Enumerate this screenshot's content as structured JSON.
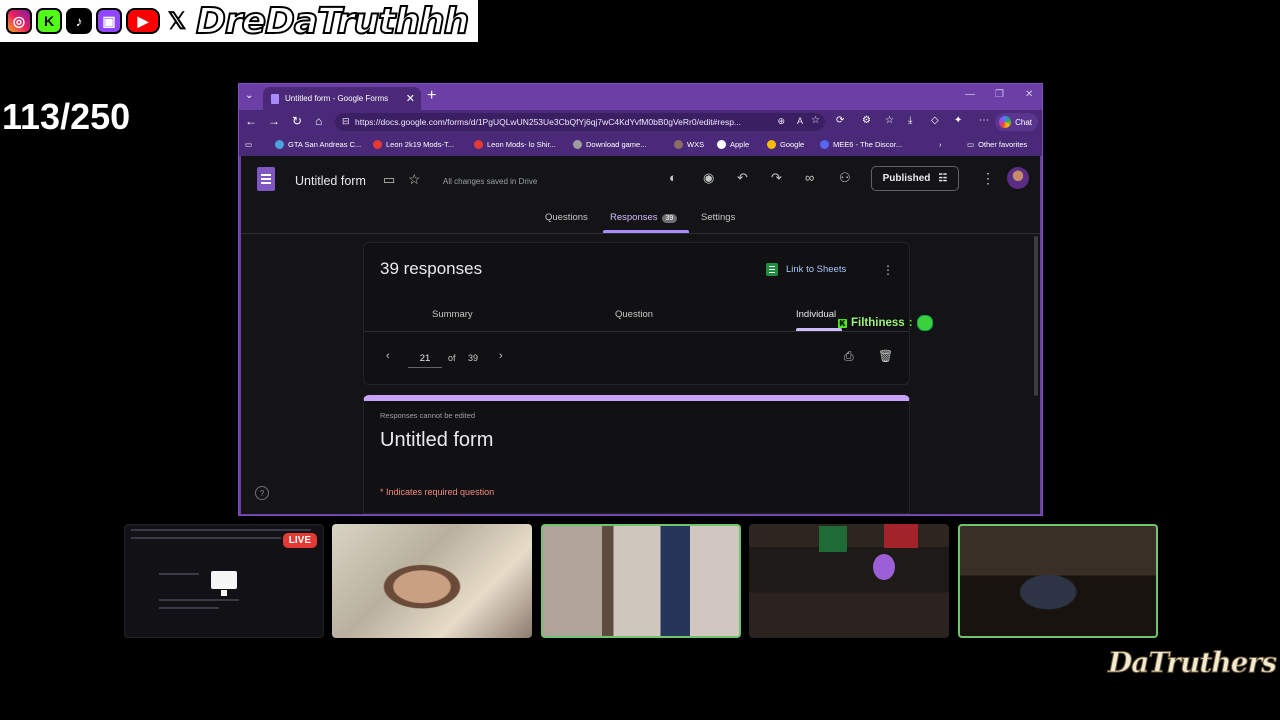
{
  "overlay": {
    "social_name": "DreDaTruthhh",
    "counter": "113/250",
    "chat": {
      "name": "Filthiness",
      "sep": " :"
    },
    "live_badge": "LIVE",
    "brand_logo": "DaTruthers"
  },
  "browser": {
    "tab_title": "Untitled form - Google Forms",
    "url": "https://docs.google.com/forms/d/1PgUQLwUN253Ue3CbQfYj6qj7wC4KdYvfM0bB0gVeRr0/edit#resp...",
    "chat_label": "Chat",
    "bookmarks": [
      "GTA San Andreas C...",
      "Leon 2k19 Mods-T...",
      "Leon Mods- lo Shir...",
      "Download game...",
      "WXS",
      "Apple",
      "Google",
      "MEE6 - The Discor..."
    ],
    "other_favorites": "Other favorites"
  },
  "forms": {
    "title": "Untitled form",
    "saved_status": "All changes saved in Drive",
    "publish_label": "Published",
    "tabs": {
      "questions": "Questions",
      "responses": "Responses",
      "responses_count": "39",
      "settings": "Settings"
    },
    "responses": {
      "count_label": "39 responses",
      "link_sheets": "Link to Sheets",
      "subtabs": {
        "summary": "Summary",
        "question": "Question",
        "individual": "Individual"
      },
      "pager": {
        "current": "21",
        "of": "of",
        "total": "39"
      }
    },
    "preview": {
      "cannot_edit": "Responses cannot be edited",
      "title": "Untitled form",
      "required_note": "* Indicates required question"
    }
  },
  "colors": {
    "browser_frame": "#6b3fa6",
    "forms_bg": "#141416",
    "accent_purple": "#a98bff",
    "live_red": "#e53935",
    "kick_green": "#53fc18"
  }
}
